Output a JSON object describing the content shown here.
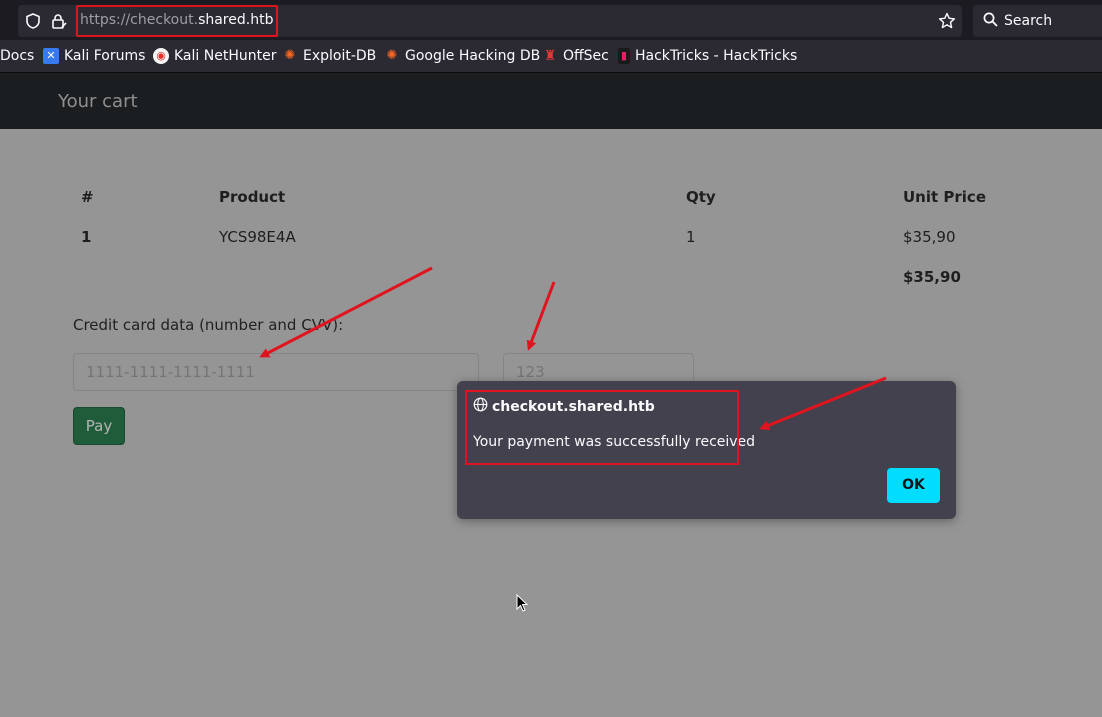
{
  "browser": {
    "url_prefix": "https://checkout.",
    "url_domain": "shared.htb",
    "search_placeholder": "Search",
    "bookmarks": [
      {
        "label": "Docs",
        "icon": "docs-icon",
        "color": "#2b2a33"
      },
      {
        "label": "Kali Forums",
        "icon": "kali-forums-icon",
        "color": "#367bf0"
      },
      {
        "label": "Kali NetHunter",
        "icon": "kali-nethunter-icon",
        "color": "#e4312b"
      },
      {
        "label": "Exploit-DB",
        "icon": "exploit-db-icon",
        "color": "#f26522"
      },
      {
        "label": "Google Hacking DB",
        "icon": "ghdb-icon",
        "color": "#f26522"
      },
      {
        "label": "OffSec",
        "icon": "offsec-icon",
        "color": "#d32f2f"
      },
      {
        "label": "HackTricks - HackTricks",
        "icon": "hacktricks-icon",
        "color": "#c2185b"
      }
    ]
  },
  "page": {
    "brand": "Your cart",
    "table": {
      "headers": [
        "#",
        "Product",
        "Qty",
        "Unit Price"
      ],
      "rows": [
        [
          "1",
          "YCS98E4A",
          "1",
          "$35,90"
        ]
      ],
      "total": "$35,90"
    },
    "card_label": "Credit card data (number and CVV):",
    "card_number_placeholder": "1111-1111-1111-1111",
    "cvv_placeholder": "123",
    "pay_label": "Pay"
  },
  "dialog": {
    "host": "checkout.shared.htb",
    "message": "Your payment was successfully received",
    "ok_label": "OK"
  },
  "colors": {
    "annotation": "#e0141e",
    "ok_button": "#00ddff",
    "pay_button": "#1f5c3a"
  }
}
